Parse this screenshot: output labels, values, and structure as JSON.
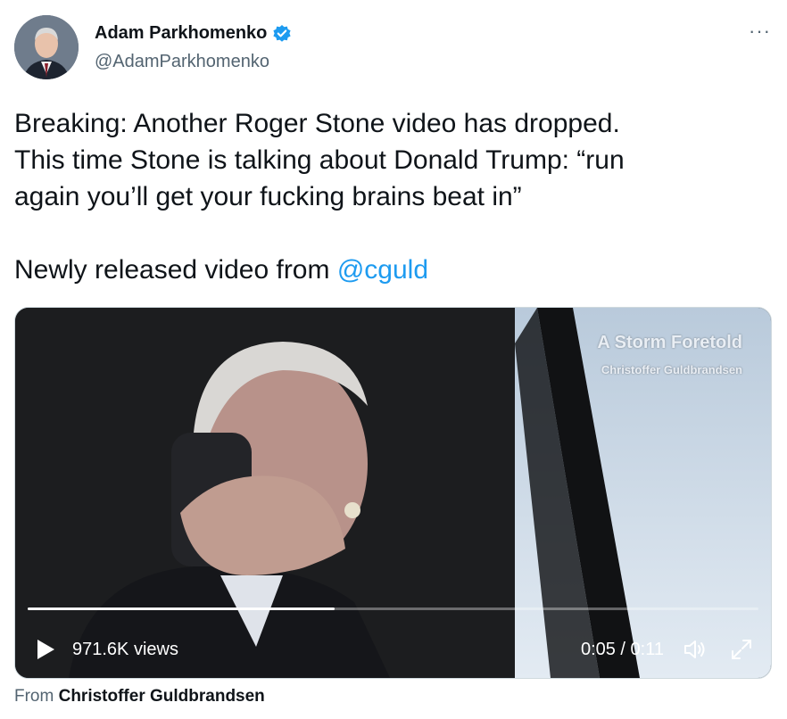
{
  "author": {
    "name": "Adam Parkhomenko",
    "handle": "@AdamParkhomenko",
    "verified_color": "#1d9bf0"
  },
  "menu": {
    "more_label": "···"
  },
  "tweet": {
    "line1": "Breaking: Another Roger Stone video has dropped.",
    "line2": "This time Stone is talking about Donald Trump: “run",
    "line3": "again you’ll get your fucking brains beat in”",
    "line4_prefix": "Newly released video from ",
    "mention": "@cguld"
  },
  "video": {
    "overlay_title": "A Storm Foretold",
    "overlay_subtitle": "Christoffer Guldbrandsen",
    "views": "971.6K views",
    "time": "0:05 / 0:11",
    "progress_fraction": 0.42
  },
  "attribution": {
    "prefix": "From ",
    "source": "Christoffer Guldbrandsen"
  },
  "colors": {
    "link": "#1d9bf0",
    "text": "#0f1419",
    "secondary": "#536471"
  }
}
